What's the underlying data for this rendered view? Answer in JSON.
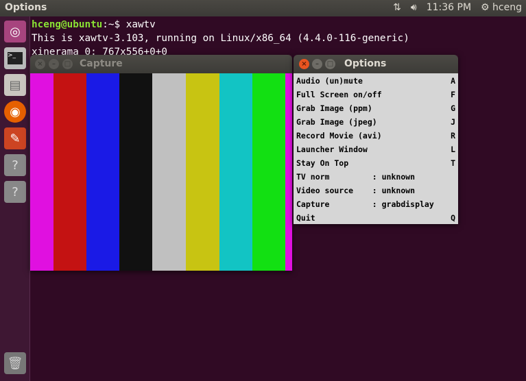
{
  "topbar": {
    "title": "Options",
    "time": "11:36 PM",
    "user": "hceng",
    "icons": [
      "network-icon",
      "volume-icon",
      "gear-icon"
    ]
  },
  "launcher": {
    "items": [
      "ubuntu-dash-icon",
      "terminal-icon",
      "files-icon",
      "firefox-icon",
      "settings-icon",
      "unknown-app-icon",
      "unknown-app-icon",
      "trash-icon"
    ]
  },
  "terminal": {
    "prompt_user": "hceng@ubuntu",
    "prompt_path": ":~$ ",
    "command": "xawtv",
    "lines": [
      "This is xawtv-3.103, running on Linux/x86_64 (4.4.0-116-generic)",
      "xinerama 0: 767x556+0+0"
    ]
  },
  "capture": {
    "title": "Capture",
    "bars": [
      "#e010e0",
      "#c41212",
      "#1a1ae6",
      "#111111",
      "#c0c0c0",
      "#c8c412",
      "#12c4c4",
      "#12e012",
      "#e010e0"
    ]
  },
  "options": {
    "title": "Options",
    "items": [
      {
        "label": "Audio (un)mute",
        "key": "A"
      },
      {
        "label": "Full Screen on/off",
        "key": "F"
      },
      {
        "label": "Grab Image (ppm)",
        "key": "G"
      },
      {
        "label": "Grab Image (jpeg)",
        "key": "J"
      },
      {
        "label": "Record Movie (avi)",
        "key": "R"
      },
      {
        "label": "Launcher Window",
        "key": "L"
      },
      {
        "label": "Stay On Top",
        "key": "T"
      },
      {
        "label": "TV norm         : unknown",
        "key": ""
      },
      {
        "label": "Video source    : unknown",
        "key": ""
      },
      {
        "label": "Capture         : grabdisplay",
        "key": ""
      },
      {
        "label": "Quit",
        "key": "Q"
      }
    ]
  }
}
